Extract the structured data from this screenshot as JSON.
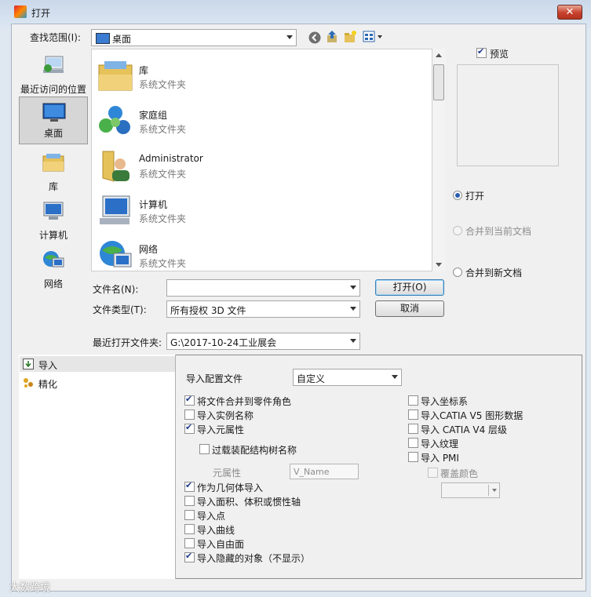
{
  "window": {
    "title": "打开",
    "close_label": "✕"
  },
  "toolbar": {
    "look_in_label": "查找范围(I):",
    "look_in_value": "桌面"
  },
  "places": [
    {
      "label": "最近访问的位置",
      "icon": "recent-places-icon"
    },
    {
      "label": "桌面",
      "icon": "desktop-icon",
      "selected": true
    },
    {
      "label": "库",
      "icon": "libraries-icon"
    },
    {
      "label": "计算机",
      "icon": "computer-icon"
    },
    {
      "label": "网络",
      "icon": "network-icon"
    }
  ],
  "files": [
    {
      "name": "库",
      "type": "系统文件夹",
      "icon": "libraries-icon"
    },
    {
      "name": "家庭组",
      "type": "系统文件夹",
      "icon": "homegroup-icon"
    },
    {
      "name": "Administrator",
      "type": "系统文件夹",
      "icon": "user-folder-icon"
    },
    {
      "name": "计算机",
      "type": "系统文件夹",
      "icon": "computer-icon"
    },
    {
      "name": "网络",
      "type": "系统文件夹",
      "icon": "network-icon"
    }
  ],
  "form": {
    "filename_label": "文件名(N):",
    "filename_value": "",
    "filetype_label": "文件类型(T):",
    "filetype_value": "所有授权 3D 文件",
    "recent_label": "最近打开文件夹:",
    "recent_value": "G:\\2017-10-24工业展会",
    "open_label": "打开(O)",
    "cancel_label": "取消"
  },
  "preview": {
    "label": "预览",
    "checked": true
  },
  "open_mode": {
    "open": "打开",
    "merge_current": "合并到当前文档",
    "merge_new": "合并到新文档"
  },
  "nav": [
    {
      "label": "导入",
      "icon": "import-icon"
    },
    {
      "label": "精化",
      "icon": "refine-icon"
    }
  ],
  "import_options": {
    "profile_label": "导入配置文件",
    "profile_value": "自定义",
    "left": [
      {
        "label": "将文件合并到零件角色",
        "checked": true
      },
      {
        "label": "导入实例名称",
        "checked": false
      },
      {
        "label": "导入元属性",
        "checked": true
      }
    ],
    "override_label": "过载装配结构树名称",
    "meta_label": "元属性",
    "meta_placeholder": "V_Name",
    "left2": [
      {
        "label": "作为几何体导入",
        "checked": true
      },
      {
        "label": "导入面积、体积或惯性轴",
        "checked": false
      },
      {
        "label": "导入点",
        "checked": false
      },
      {
        "label": "导入曲线",
        "checked": false
      },
      {
        "label": "导入自由面",
        "checked": false
      },
      {
        "label": "导入隐藏的对象（不显示）",
        "checked": true
      }
    ],
    "right": [
      {
        "label": "导入坐标系",
        "checked": false
      },
      {
        "label": "导入CATIA V5 图形数据",
        "checked": false
      },
      {
        "label": "导入 CATIA V4 层级",
        "checked": false
      },
      {
        "label": "导入纹理",
        "checked": false
      },
      {
        "label": "导入 PMI",
        "checked": false
      }
    ],
    "override_color_label": "覆盖颜色"
  },
  "watermark": "大数跨境"
}
